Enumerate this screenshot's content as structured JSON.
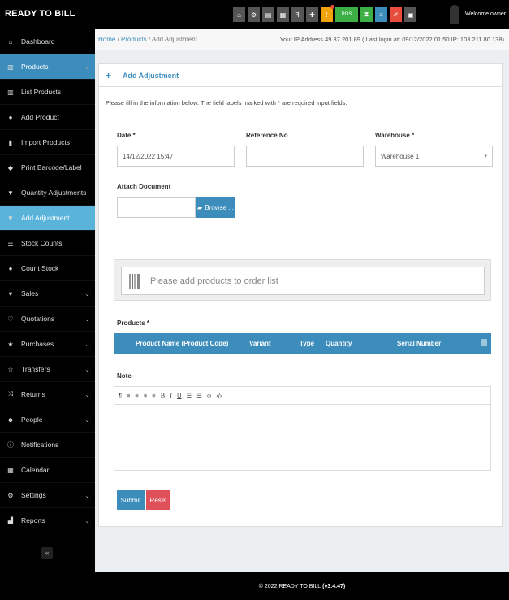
{
  "brand": "READY TO BILL",
  "topbar": {
    "pos_label": "POS",
    "welcome": "Welcome owner"
  },
  "breadcrumb": {
    "home": "Home",
    "sep1": "/",
    "products": "Products",
    "sep2": "/",
    "current": "Add Adjustment"
  },
  "ip_info": "Your IP Address 49.37.201.89 ( Last login at: 09/12/2022 01:50 IP: 103.211.80.138)",
  "sidebar": {
    "items": [
      {
        "label": "Dashboard",
        "icon": "dashboard-icon"
      },
      {
        "label": "Products",
        "icon": "barcode-icon"
      },
      {
        "label": "List Products",
        "icon": "barcode-icon"
      },
      {
        "label": "Add Product",
        "icon": "plus-circle-icon"
      },
      {
        "label": "Import Products",
        "icon": "file-icon"
      },
      {
        "label": "Print Barcode/Label",
        "icon": "tag-icon"
      },
      {
        "label": "Quantity Adjustments",
        "icon": "filter-icon"
      },
      {
        "label": "Add Adjustment",
        "icon": "filter-icon"
      },
      {
        "label": "Stock Counts",
        "icon": "list-icon"
      },
      {
        "label": "Count Stock",
        "icon": "plus-circle-icon"
      },
      {
        "label": "Sales",
        "icon": "heart-icon"
      },
      {
        "label": "Quotations",
        "icon": "heart-outline-icon"
      },
      {
        "label": "Purchases",
        "icon": "star-icon"
      },
      {
        "label": "Transfers",
        "icon": "star-outline-icon"
      },
      {
        "label": "Returns",
        "icon": "random-icon"
      },
      {
        "label": "People",
        "icon": "users-icon"
      },
      {
        "label": "Notifications",
        "icon": "info-icon"
      },
      {
        "label": "Calendar",
        "icon": "calendar-icon"
      },
      {
        "label": "Settings",
        "icon": "gear-icon"
      },
      {
        "label": "Reports",
        "icon": "bar-chart-icon"
      }
    ],
    "collapse": "«"
  },
  "panel": {
    "title": "Add Adjustment",
    "info": "Please fill in the information below. The field labels marked with * are required input fields."
  },
  "form": {
    "date_label": "Date *",
    "date_value": "14/12/2022 15:47",
    "reference_label": "Reference No",
    "reference_value": "",
    "warehouse_label": "Warehouse *",
    "warehouse_value": "Warehouse 1",
    "attach_label": "Attach Document",
    "browse_label": "Browse ...",
    "search_placeholder": "Please add products to order list",
    "products_label": "Products *",
    "note_label": "Note",
    "submit_label": "Submit",
    "reset_label": "Reset"
  },
  "table": {
    "columns": [
      "Product Name (Product Code)",
      "Variant",
      "Type",
      "Quantity",
      "Serial Number"
    ]
  },
  "editor_toolbar": [
    "¶",
    "≡",
    "≡",
    "≡",
    "≡",
    "B",
    "I",
    "U",
    "☰",
    "☰",
    "∞",
    "‹/›"
  ],
  "footer": {
    "text": "© 2022 READY TO BILL",
    "version": "(v3.4.47)"
  },
  "colors": {
    "accent": "#3c8dbc",
    "sub_active": "#5ab4d9",
    "reset": "#e0505a"
  }
}
